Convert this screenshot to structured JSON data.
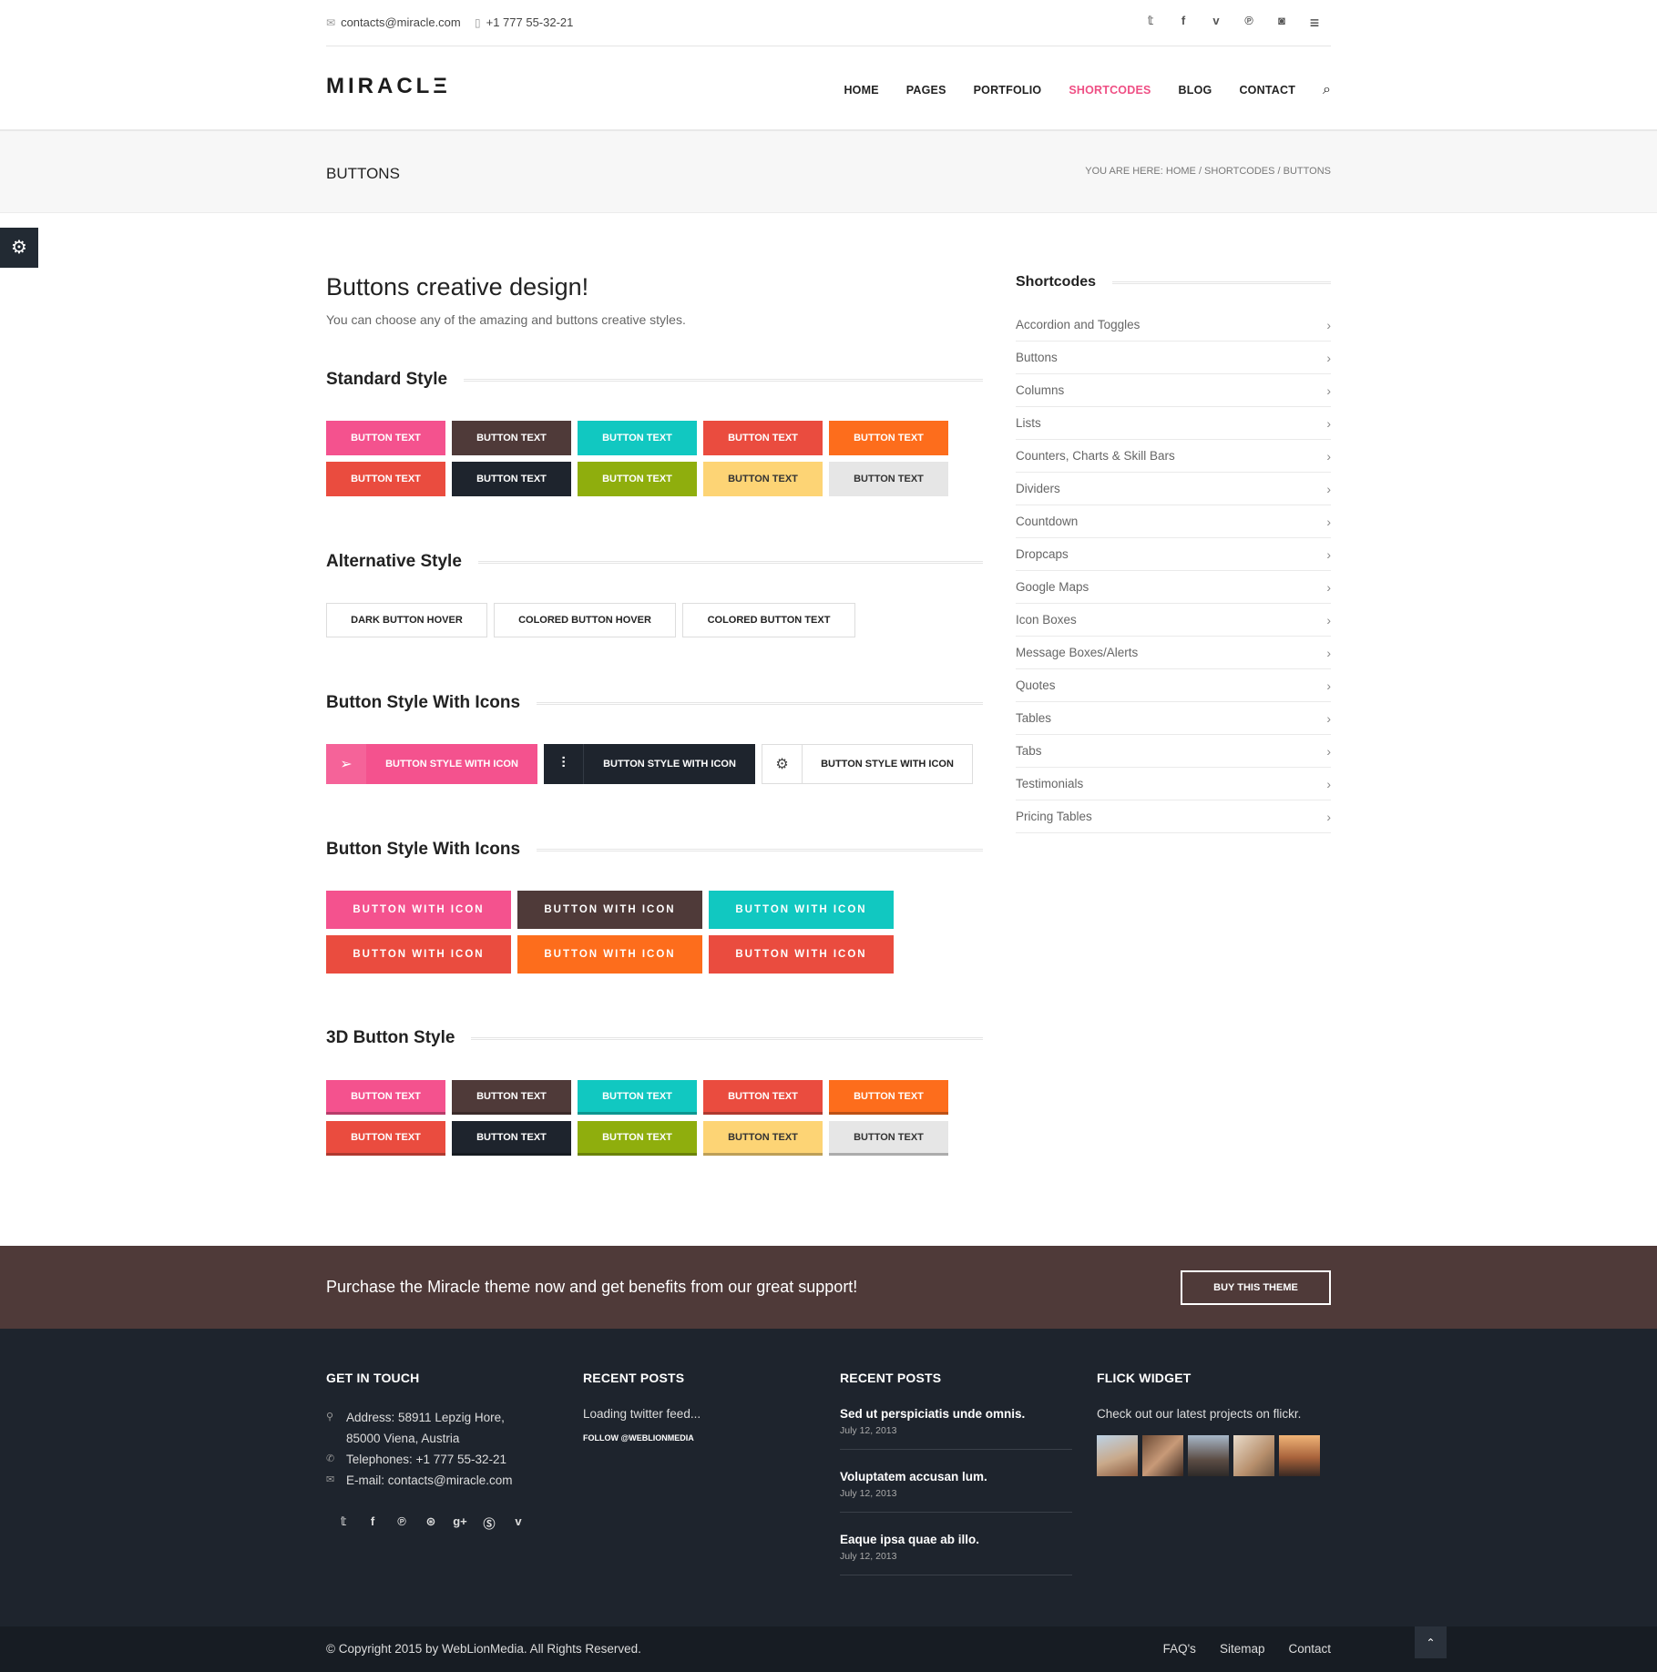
{
  "topbar": {
    "email": "contacts@miracle.com",
    "phone": "+1 777 55-32-21",
    "socials": [
      "twitter",
      "facebook",
      "vimeo",
      "pinterest",
      "instagram"
    ]
  },
  "header": {
    "logo": "MIRACLΞ",
    "nav": [
      "HOME",
      "PAGES",
      "PORTFOLIO",
      "SHORTCODES",
      "BLOG",
      "CONTACT"
    ],
    "active": "SHORTCODES"
  },
  "titleband": {
    "title": "BUTTONS",
    "breadcrumb": "YOU ARE HERE: HOME / SHORTCODES / BUTTONS"
  },
  "main": {
    "heading": "Buttons creative design!",
    "subheading": "You can choose any of the amazing and buttons creative styles.",
    "sections": {
      "standard": "Standard Style",
      "alternative": "Alternative Style",
      "icons1": "Button Style With Icons",
      "icons2": "Button Style With Icons",
      "threed": "3D Button Style"
    },
    "button_text": "BUTTON TEXT",
    "alt_buttons": [
      "DARK BUTTON HOVER",
      "COLORED BUTTON HOVER",
      "COLORED BUTTON TEXT"
    ],
    "icon_button_label": "BUTTON STYLE WITH ICON",
    "wide_button_label": "BUTTON WITH ICON"
  },
  "colors": {
    "pink": "#f4528e",
    "brown": "#4f3a39",
    "teal": "#11c8c1",
    "red": "#ea4c3f",
    "orange": "#fd6d1c",
    "dark": "#1e242d",
    "green": "#8fae0d",
    "yellow": "#fdd475",
    "light": "#e6e6e6"
  },
  "sidebar": {
    "title": "Shortcodes",
    "items": [
      "Accordion and Toggles",
      "Buttons",
      "Columns",
      "Lists",
      "Counters, Charts & Skill Bars",
      "Dividers",
      "Countdown",
      "Dropcaps",
      "Google Maps",
      "Icon Boxes",
      "Message Boxes/Alerts",
      "Quotes",
      "Tables",
      "Tabs",
      "Testimonials",
      "Pricing Tables"
    ]
  },
  "purchase": {
    "text": "Purchase the Miracle theme now and get benefits from our great support!",
    "button": "BUY THIS THEME"
  },
  "footer": {
    "touch_title": "GET IN TOUCH",
    "address1": "Address: 58911 Lepzig Hore,",
    "address2": "85000 Viena, Austria",
    "telephone": "Telephones: +1 777 55-32-21",
    "email": "E-mail: contacts@miracle.com",
    "recent1_title": "RECENT POSTS",
    "twitter_loading": "Loading twitter feed...",
    "follow": "FOLLOW @WEBLIONMEDIA",
    "recent2_title": "RECENT POSTS",
    "posts": [
      {
        "title": "Sed ut perspiciatis unde omnis.",
        "date": "July 12, 2013"
      },
      {
        "title": "Voluptatem accusan lum.",
        "date": "July 12, 2013"
      },
      {
        "title": "Eaque ipsa quae ab illo.",
        "date": "July 12, 2013"
      }
    ],
    "flick_title": "FLICK WIDGET",
    "flick_text": "Check out our latest projects on flickr."
  },
  "bottom": {
    "copyright": "© Copyright 2015 by WebLionMedia. All Rights Reserved.",
    "links": [
      "FAQ's",
      "Sitemap",
      "Contact"
    ]
  }
}
